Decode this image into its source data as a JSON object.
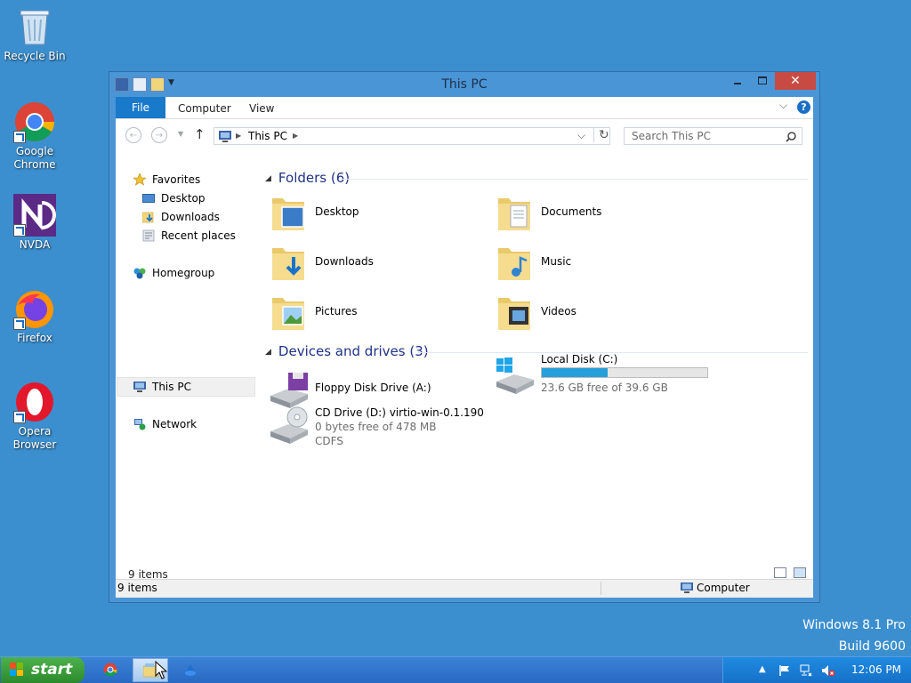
{
  "desktop": {
    "icons": [
      {
        "label": "Recycle Bin"
      },
      {
        "label": "Google Chrome"
      },
      {
        "label": "NVDA"
      },
      {
        "label": "Firefox"
      },
      {
        "label": "Opera Browser"
      }
    ],
    "watermark": {
      "line1": "Windows 8.1 Pro",
      "line2": "Build 9600"
    }
  },
  "window": {
    "title": "This PC",
    "close_glyph": "✕",
    "ribbon": {
      "file": "File",
      "computer": "Computer",
      "view": "View",
      "help": "?"
    },
    "address": {
      "path": "This PC"
    },
    "search": {
      "placeholder": "Search This PC"
    },
    "nav": {
      "favorites": "Favorites",
      "desktop": "Desktop",
      "downloads": "Downloads",
      "recent": "Recent places",
      "homegroup": "Homegroup",
      "thispc": "This PC",
      "network": "Network"
    },
    "folders_group": "Folders (6)",
    "folders": [
      {
        "label": "Desktop"
      },
      {
        "label": "Documents"
      },
      {
        "label": "Downloads"
      },
      {
        "label": "Music"
      },
      {
        "label": "Pictures"
      },
      {
        "label": "Videos"
      }
    ],
    "devices_group": "Devices and drives (3)",
    "drives": {
      "floppy": {
        "name": "Floppy Disk Drive (A:)"
      },
      "local": {
        "name": "Local Disk (C:)",
        "free": "23.6 GB free of 39.6 GB",
        "used_fraction": 0.4
      },
      "cd": {
        "name": "CD Drive (D:) virtio-win-0.1.190",
        "free": "0 bytes free of 478 MB",
        "fs": "CDFS"
      }
    },
    "items_count": "9 items",
    "status": {
      "left": "9 items",
      "right": "Computer"
    }
  },
  "taskbar": {
    "start": "start",
    "clock": "12:06 PM"
  },
  "colors": {
    "accent": "#1979ca",
    "desktop": "#3c8fcf",
    "close": "#c74b43",
    "disk_bar": "#26a0da"
  }
}
